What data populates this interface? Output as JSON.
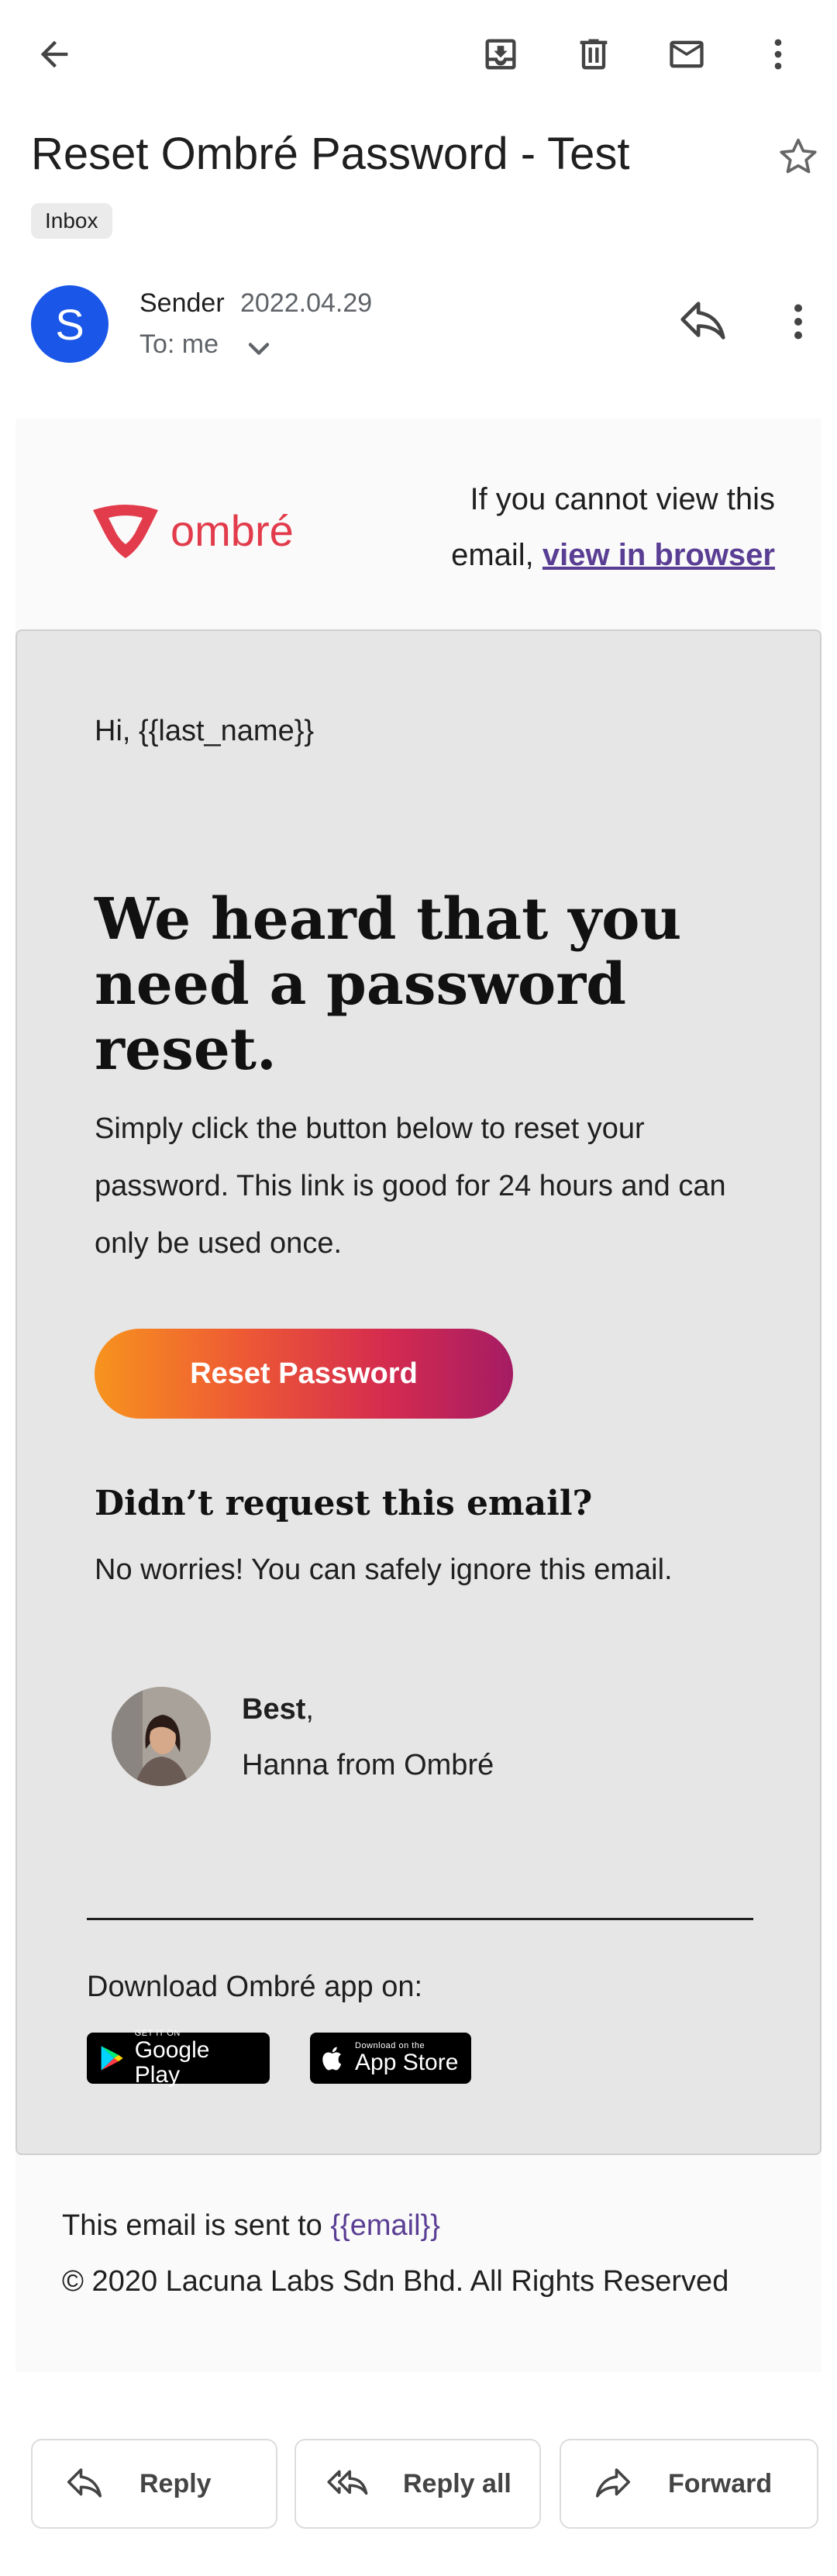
{
  "toolbar": {
    "back_icon": "arrow-left-icon",
    "archive_icon": "archive-icon",
    "delete_icon": "trash-icon",
    "mark_unread_icon": "mail-icon",
    "more_icon": "more-vert-icon"
  },
  "message": {
    "subject": "Reset Ombré Password - Test",
    "label": "Inbox",
    "sender_initial": "S",
    "sender_name": "Sender",
    "date": "2022.04.29",
    "to": "To: me"
  },
  "email": {
    "logo_text": "ombré",
    "view_prefix": "If you cannot view this email, ",
    "view_link": "view in browser",
    "greeting": "Hi, {{last_name}}",
    "headline": "We heard that you need a password reset.",
    "body": "Simply click the button below to reset your password. This link is good for 24 hours and can only be used once.",
    "cta": "Reset Password",
    "didnt_request": "Didn’t request this email?",
    "no_worries": "No worries! You can safely ignore this email.",
    "sig_best": "Best",
    "sig_comma": ",",
    "sig_name": "Hanna from Ombré",
    "download_label": "Download Ombré app on:",
    "google_play_small": "GET IT ON",
    "google_play_big": "Google Play",
    "app_store_small": "Download on the",
    "app_store_big": "App Store",
    "footer_prefix": "This email is sent to ",
    "footer_email": "{{email}}",
    "copyright": "© 2020 Lacuna Labs Sdn Bhd. All Rights Reserved",
    "brand_color": "#e23b4b",
    "link_color": "#5a3e94"
  },
  "actions": {
    "reply": "Reply",
    "reply_all": "Reply all",
    "forward": "Forward"
  }
}
